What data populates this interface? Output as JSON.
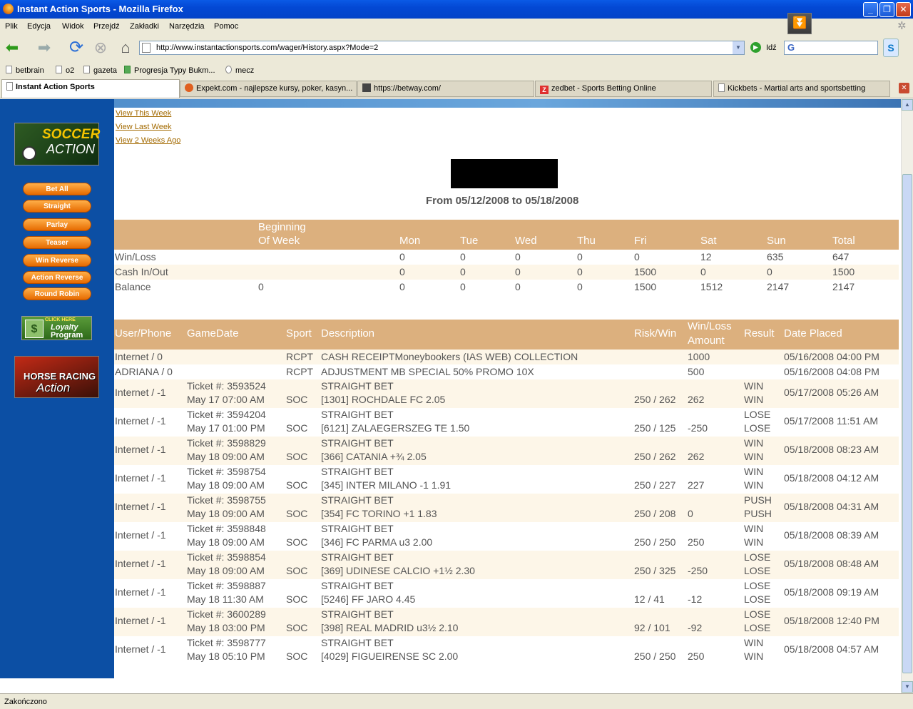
{
  "window": {
    "title": "Instant Action Sports - Mozilla Firefox"
  },
  "menu": [
    "Plik",
    "Edycja",
    "Widok",
    "Przejdź",
    "Zakładki",
    "Narzędzia",
    "Pomoc"
  ],
  "navbar": {
    "url": "http://www.instantactionsports.com/wager/History.aspx?Mode=2",
    "go_label": "Idź"
  },
  "bookmarks": [
    "betbrain",
    "o2",
    "gazeta",
    "Progresja Typy Bukm...",
    "mecz"
  ],
  "tabs": [
    "Instant Action Sports",
    "Expekt.com - najlepsze kursy, poker, kasyn...",
    "https://betway.com/",
    "zedbet - Sports Betting Online",
    "Kickbets - Martial arts and sportsbetting"
  ],
  "status": "Zakończono",
  "sidebar": {
    "soccer_logo": [
      "SOCCER",
      "ACTION"
    ],
    "buttons": [
      "Bet All",
      "Straight",
      "Parlay",
      "Teaser",
      "Win Reverse",
      "Action Reverse",
      "Round Robin"
    ],
    "loyalty": [
      "CLICK HERE",
      "Loyalty",
      "Program"
    ],
    "horse": [
      "HORSE RACING",
      "Action"
    ]
  },
  "links": [
    "View This Week",
    "View Last Week",
    "View 2 Weeks Ago"
  ],
  "range": "From 05/12/2008 to 05/18/2008",
  "summary": {
    "headers": [
      "Beginning",
      "Of Week",
      "Mon",
      "Tue",
      "Wed",
      "Thu",
      "Fri",
      "Sat",
      "Sun",
      "Total"
    ],
    "rows": [
      [
        "Win/Loss",
        "",
        "0",
        "0",
        "0",
        "0",
        "0",
        "12",
        "635",
        "647"
      ],
      [
        "Cash In/Out",
        "",
        "0",
        "0",
        "0",
        "0",
        "1500",
        "0",
        "0",
        "1500"
      ],
      [
        "Balance",
        "0",
        "0",
        "0",
        "0",
        "0",
        "1500",
        "1512",
        "2147",
        "2147"
      ]
    ]
  },
  "transactions": {
    "headers": [
      "User/Phone",
      "GameDate",
      "Sport",
      "Description",
      "Risk/Win",
      "Win/Loss",
      "Amount",
      "Result",
      "Date Placed"
    ],
    "simple": [
      [
        "Internet / 0",
        "RCPT",
        "CASH RECEIPTMoneybookers (IAS WEB) COLLECTION",
        "1000",
        "05/16/2008 04:00 PM"
      ],
      [
        "ADRIANA / 0",
        "RCPT",
        "ADJUSTMENT MB SPECIAL 50% PROMO 10X",
        "500",
        "05/16/2008 04:08 PM"
      ]
    ],
    "bets": [
      [
        "Internet / -1",
        "Ticket #: 3593524",
        "May 17 07:00 AM",
        "SOC",
        "STRAIGHT BET",
        "[1301] ROCHDALE FC 2.05",
        "250 / 262",
        "262",
        "WIN",
        "WIN",
        "05/17/2008 05:26 AM"
      ],
      [
        "Internet / -1",
        "Ticket #: 3594204",
        "May 17 01:00 PM",
        "SOC",
        "STRAIGHT BET",
        "[6121] ZALAEGERSZEG TE 1.50",
        "250 / 125",
        "-250",
        "LOSE",
        "LOSE",
        "05/17/2008 11:51 AM"
      ],
      [
        "Internet / -1",
        "Ticket #: 3598829",
        "May 18 09:00 AM",
        "SOC",
        "STRAIGHT BET",
        "[366] CATANIA +¾ 2.05",
        "250 / 262",
        "262",
        "WIN",
        "WIN",
        "05/18/2008 08:23 AM"
      ],
      [
        "Internet / -1",
        "Ticket #: 3598754",
        "May 18 09:00 AM",
        "SOC",
        "STRAIGHT BET",
        "[345] INTER MILANO -1 1.91",
        "250 / 227",
        "227",
        "WIN",
        "WIN",
        "05/18/2008 04:12 AM"
      ],
      [
        "Internet / -1",
        "Ticket #: 3598755",
        "May 18 09:00 AM",
        "SOC",
        "STRAIGHT BET",
        "[354] FC TORINO +1 1.83",
        "250 / 208",
        "0",
        "PUSH",
        "PUSH",
        "05/18/2008 04:31 AM"
      ],
      [
        "Internet / -1",
        "Ticket #: 3598848",
        "May 18 09:00 AM",
        "SOC",
        "STRAIGHT BET",
        "[346] FC PARMA u3 2.00",
        "250 / 250",
        "250",
        "WIN",
        "WIN",
        "05/18/2008 08:39 AM"
      ],
      [
        "Internet / -1",
        "Ticket #: 3598854",
        "May 18 09:00 AM",
        "SOC",
        "STRAIGHT BET",
        "[369] UDINESE CALCIO +1½ 2.30",
        "250 / 325",
        "-250",
        "LOSE",
        "LOSE",
        "05/18/2008 08:48 AM"
      ],
      [
        "Internet / -1",
        "Ticket #: 3598887",
        "May 18 11:30 AM",
        "SOC",
        "STRAIGHT BET",
        "[5246] FF JARO 4.45",
        "12 / 41",
        "-12",
        "LOSE",
        "LOSE",
        "05/18/2008 09:19 AM"
      ],
      [
        "Internet / -1",
        "Ticket #: 3600289",
        "May 18 03:00 PM",
        "SOC",
        "STRAIGHT BET",
        "[398] REAL MADRID u3½ 2.10",
        "92 / 101",
        "-92",
        "LOSE",
        "LOSE",
        "05/18/2008 12:40 PM"
      ],
      [
        "Internet / -1",
        "Ticket #: 3598777",
        "May 18 05:10 PM",
        "SOC",
        "STRAIGHT BET",
        "[4029] FIGUEIRENSE SC 2.00",
        "250 / 250",
        "250",
        "WIN",
        "WIN",
        "05/18/2008 04:57 AM"
      ]
    ]
  }
}
